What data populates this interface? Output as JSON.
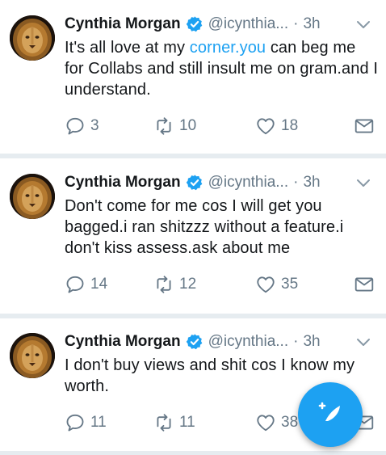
{
  "tweets": [
    {
      "author_name": "Cynthia Morgan",
      "author_handle": "@icynthia...",
      "separator": "·",
      "time": "3h",
      "text_before": "It's all love at my ",
      "mention": "corner.you",
      "text_after": " can beg me for Collabs and still insult me on gram.and I understand.",
      "replies": "3",
      "retweets": "10",
      "likes": "18"
    },
    {
      "author_name": "Cynthia Morgan",
      "author_handle": "@icynthia...",
      "separator": "·",
      "time": "3h",
      "text_before": "Don't come for me cos I will get you bagged.i ran shitzzz without a feature.i don't kiss assess.ask about me",
      "mention": "",
      "text_after": "",
      "replies": "14",
      "retweets": "12",
      "likes": "35"
    },
    {
      "author_name": "Cynthia Morgan",
      "author_handle": "@icynthia...",
      "separator": "·",
      "time": "3h",
      "text_before": "I don't buy views and shit cos I know my worth.",
      "mention": "",
      "text_after": "",
      "replies": "11",
      "retweets": "11",
      "likes": "38"
    }
  ],
  "icons": {
    "verified": "verified-badge-icon",
    "caret": "chevron-down-icon",
    "reply": "reply-icon",
    "retweet": "retweet-icon",
    "like": "heart-icon",
    "dm": "envelope-icon",
    "compose": "compose-tweet-icon"
  },
  "colors": {
    "accent": "#1da1f2",
    "text": "#14171a",
    "secondary": "#657786",
    "separator": "#e6ecf0"
  }
}
